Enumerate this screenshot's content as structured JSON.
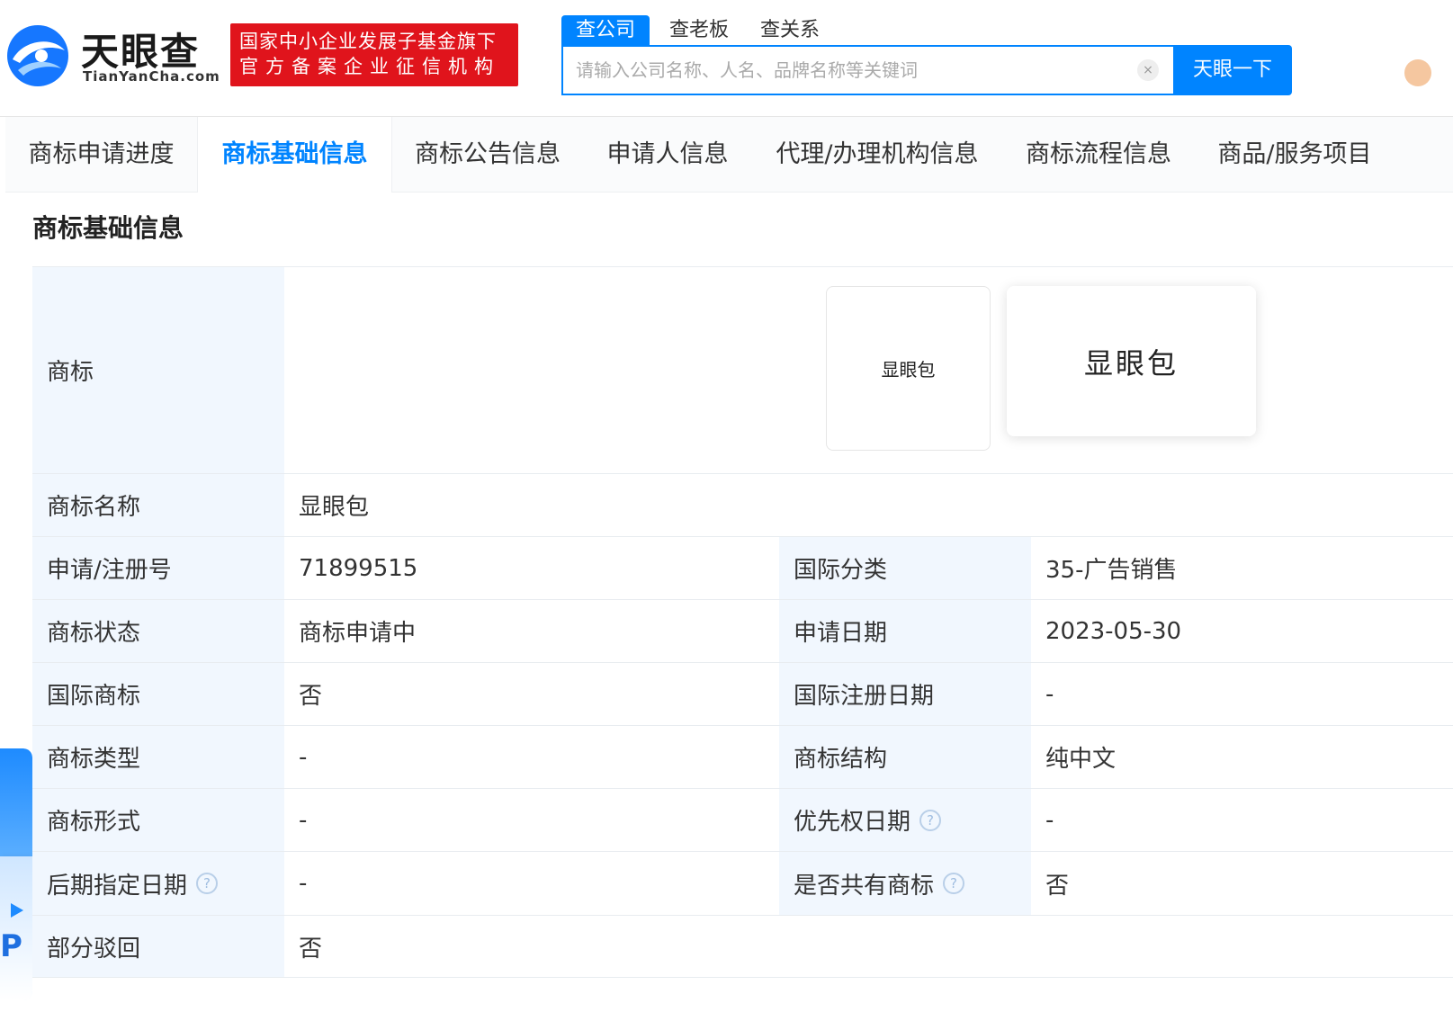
{
  "header": {
    "logo_cn": "天眼查",
    "logo_en": "TianYanCha.com",
    "badge_line1": "国家中小企业发展子基金旗下",
    "badge_line2": "官方备案企业征信机构",
    "search_tabs": [
      "查公司",
      "查老板",
      "查关系"
    ],
    "search_placeholder": "请输入公司名称、人名、品牌名称等关键词",
    "clear_label": "×",
    "search_button": "天眼一下"
  },
  "tabs": [
    "商标申请进度",
    "商标基础信息",
    "商标公告信息",
    "申请人信息",
    "代理/办理机构信息",
    "商标流程信息",
    "商品/服务项目"
  ],
  "active_tab": "商标基础信息",
  "section_title": "商标基础信息",
  "trademark": {
    "label": "商标",
    "image_text_small": "显眼包",
    "image_text_large": "显眼包"
  },
  "rows": {
    "name": {
      "label": "商标名称",
      "value": "显眼包"
    },
    "reg_no": {
      "label": "申请/注册号",
      "value": "71899515",
      "label2": "国际分类",
      "value2": "35-广告销售"
    },
    "status": {
      "label": "商标状态",
      "value": "商标申请中",
      "label2": "申请日期",
      "value2": "2023-05-30"
    },
    "intl": {
      "label": "国际商标",
      "value": "否",
      "label2": "国际注册日期",
      "value2": "-"
    },
    "type": {
      "label": "商标类型",
      "value": "-",
      "label2": "商标结构",
      "value2": "纯中文"
    },
    "form": {
      "label": "商标形式",
      "value": "-",
      "label2": "优先权日期",
      "value2": "-"
    },
    "later": {
      "label": "后期指定日期",
      "value": "-",
      "label2": "是否共有商标",
      "value2": "否"
    },
    "partial": {
      "label": "部分驳回",
      "value": "否"
    }
  },
  "help_glyph": "?",
  "float_widget_letter": "P",
  "colors": {
    "accent": "#0084ff",
    "badge_red": "#e0141c",
    "label_bg": "#f1f7fe"
  }
}
